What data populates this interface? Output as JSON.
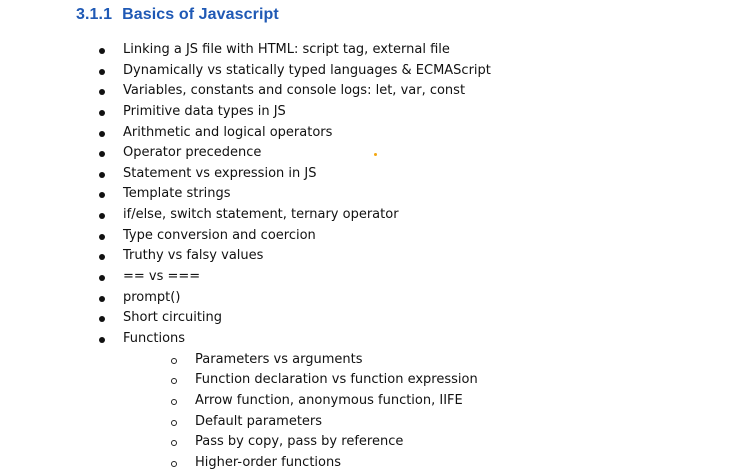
{
  "section": {
    "number": "3.1.1",
    "title": "Basics of Javascript"
  },
  "items": [
    {
      "label": "Linking a JS file with HTML: script tag, external file",
      "level": 1
    },
    {
      "label": "Dynamically vs statically typed languages & ECMAScript",
      "level": 1
    },
    {
      "label": "Variables, constants and console logs: let, var, const",
      "level": 1
    },
    {
      "label": "Primitive data types in JS",
      "level": 1
    },
    {
      "label": "Arithmetic and logical operators",
      "level": 1
    },
    {
      "label": "Operator precedence",
      "level": 1
    },
    {
      "label": "Statement vs expression in JS",
      "level": 1
    },
    {
      "label": "Template strings",
      "level": 1
    },
    {
      "label": "if/else, switch statement, ternary operator",
      "level": 1
    },
    {
      "label": "Type conversion and coercion",
      "level": 1
    },
    {
      "label": "Truthy vs falsy values",
      "level": 1
    },
    {
      "label": "== vs ===",
      "level": 1
    },
    {
      "label": "prompt()",
      "level": 1
    },
    {
      "label": "Short circuiting",
      "level": 1
    },
    {
      "label": "Functions",
      "level": 1
    },
    {
      "label": "Parameters vs arguments",
      "level": 2
    },
    {
      "label": "Function declaration vs function expression",
      "level": 2
    },
    {
      "label": "Arrow function, anonymous function, IIFE",
      "level": 2
    },
    {
      "label": "Default parameters",
      "level": 2
    },
    {
      "label": "Pass by copy, pass by reference",
      "level": 2
    },
    {
      "label": "Higher-order functions",
      "level": 2
    }
  ],
  "colors": {
    "heading": "#1f59b5",
    "text": "#111111",
    "stray_dot": "#f3a712"
  }
}
